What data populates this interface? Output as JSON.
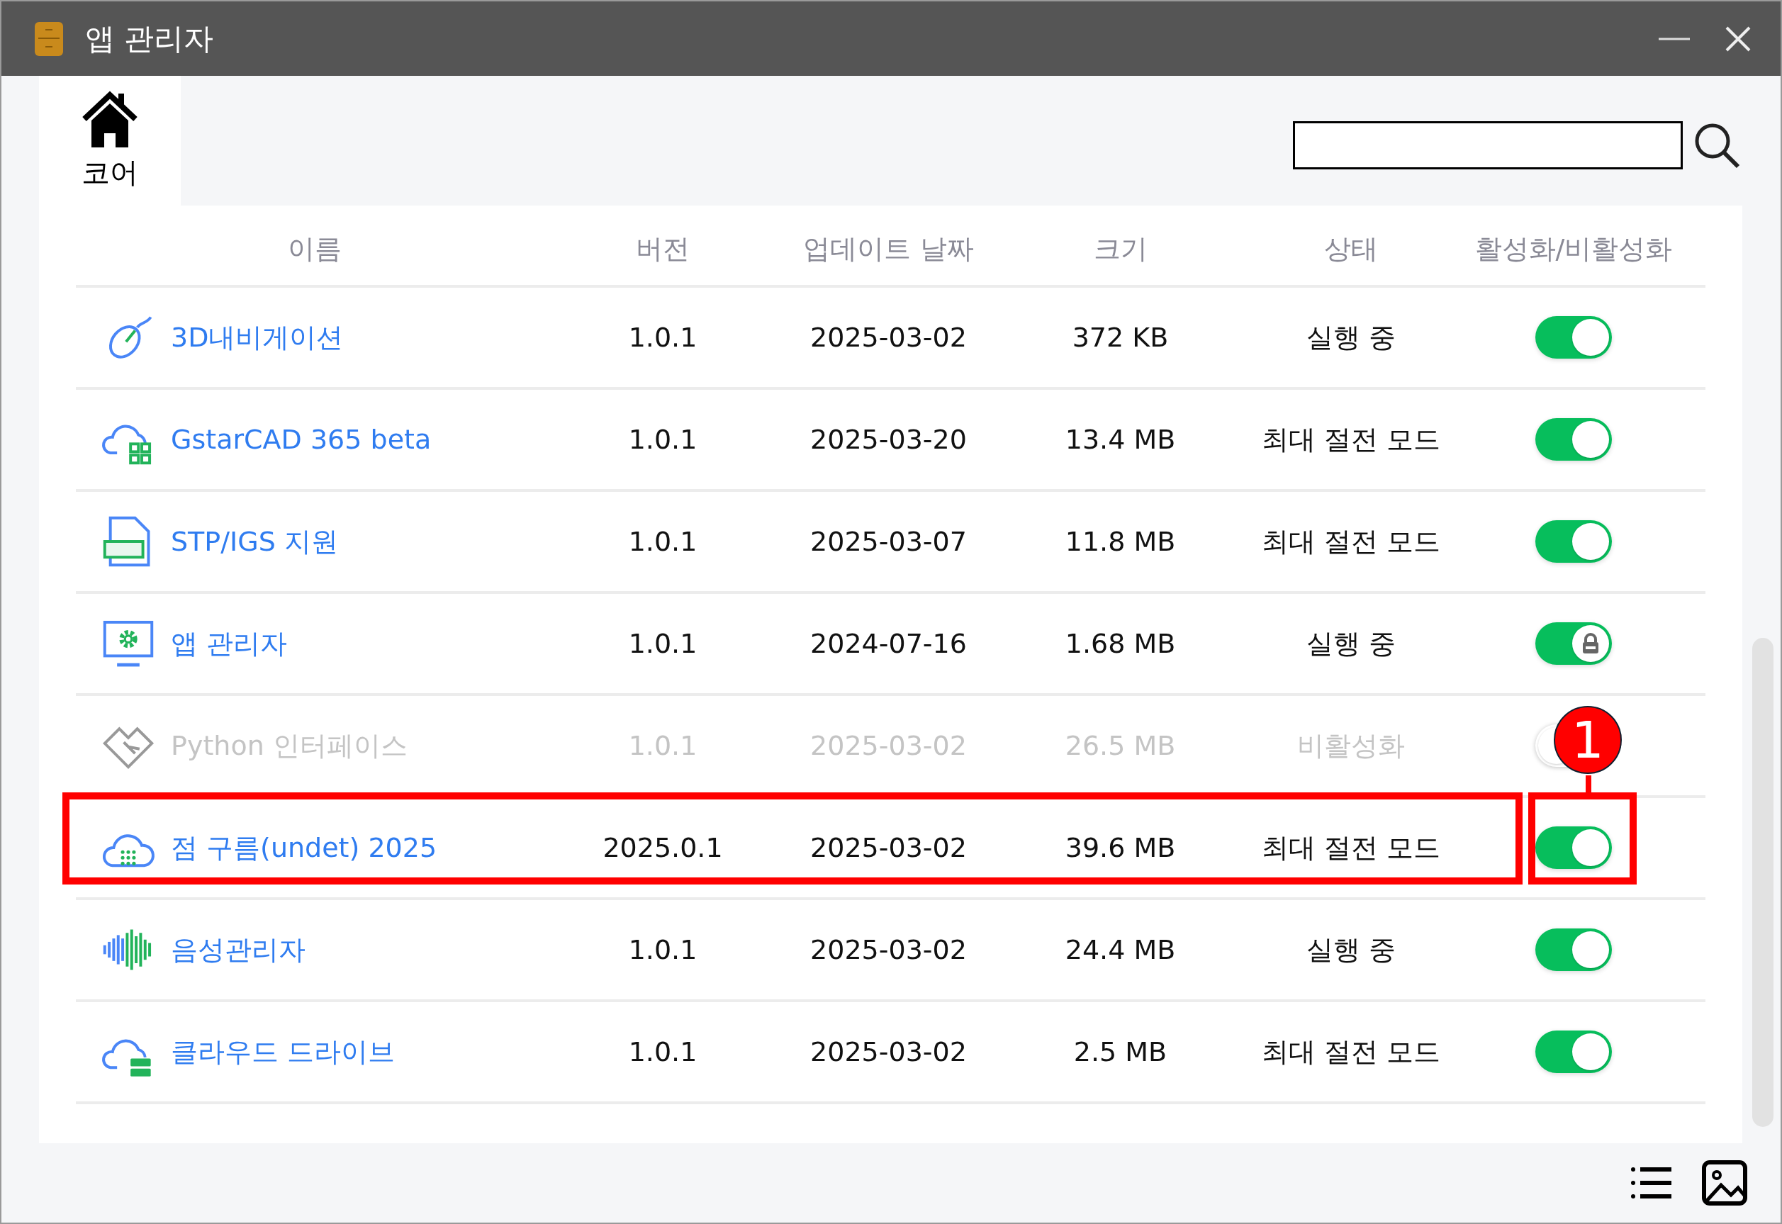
{
  "window": {
    "title": "앱 관리자"
  },
  "tabs": [
    {
      "label": "코어",
      "selected": true
    }
  ],
  "table": {
    "columns": [
      "이름",
      "버전",
      "업데이트 날짜",
      "크기",
      "상태",
      "활성화/비활성화"
    ],
    "rows": [
      {
        "kind": "mouse",
        "name": "3D내비게이션",
        "version": "1.0.1",
        "date": "2025-03-02",
        "size": "372 KB",
        "status": "실행 중",
        "enabled": true,
        "on": true,
        "locked": false,
        "highlighted": false
      },
      {
        "kind": "cloud-grid",
        "name": "GstarCAD 365 beta",
        "version": "1.0.1",
        "date": "2025-03-20",
        "size": "13.4 MB",
        "status": "최대 절전 모드",
        "enabled": true,
        "on": true,
        "locked": false,
        "highlighted": false
      },
      {
        "kind": "document",
        "name": "STP/IGS 지원",
        "version": "1.0.1",
        "date": "2025-03-07",
        "size": "11.8 MB",
        "status": "최대 절전 모드",
        "enabled": true,
        "on": true,
        "locked": false,
        "highlighted": false
      },
      {
        "kind": "monitor",
        "name": "앱 관리자",
        "version": "1.0.1",
        "date": "2024-07-16",
        "size": "1.68 MB",
        "status": "실행 중",
        "enabled": true,
        "on": true,
        "locked": true,
        "highlighted": false
      },
      {
        "kind": "handshake",
        "name": "Python 인터페이스",
        "version": "1.0.1",
        "date": "2025-03-02",
        "size": "26.5 MB",
        "status": "비활성화",
        "enabled": false,
        "on": false,
        "locked": false,
        "highlighted": false
      },
      {
        "kind": "cloud-dots",
        "name": "점 구름(undet) 2025",
        "version": "2025.0.1",
        "date": "2025-03-02",
        "size": "39.6 MB",
        "status": "최대 절전 모드",
        "enabled": true,
        "on": true,
        "locked": false,
        "highlighted": true
      },
      {
        "kind": "waveform",
        "name": "음성관리자",
        "version": "1.0.1",
        "date": "2025-03-02",
        "size": "24.4 MB",
        "status": "실행 중",
        "enabled": true,
        "on": true,
        "locked": false,
        "highlighted": false
      },
      {
        "kind": "cloud-drive",
        "name": "클라우드 드라이브",
        "version": "1.0.1",
        "date": "2025-03-02",
        "size": "2.5 MB",
        "status": "최대 절전 모드",
        "enabled": true,
        "on": true,
        "locked": false,
        "highlighted": false
      }
    ]
  },
  "callout": {
    "label": "1"
  }
}
